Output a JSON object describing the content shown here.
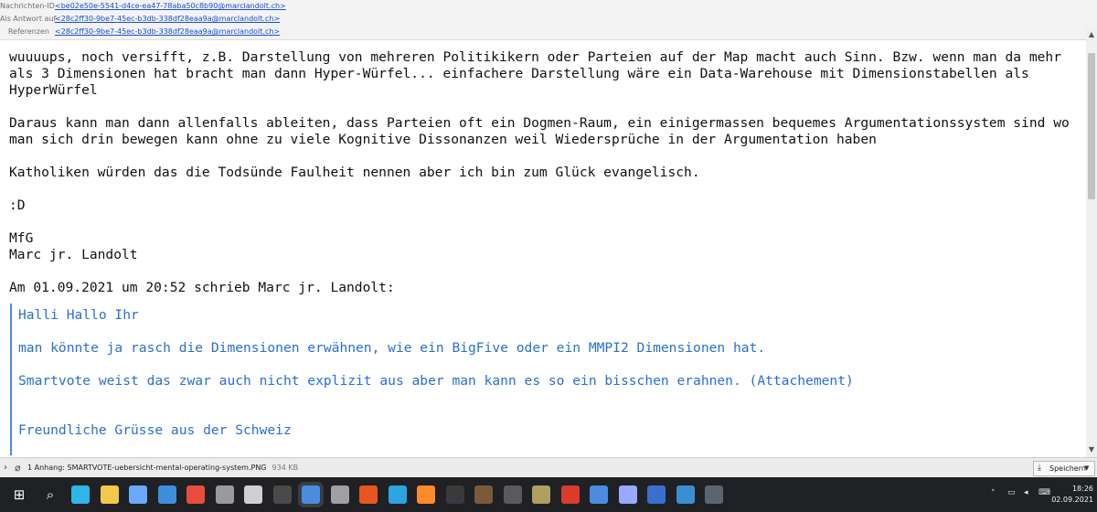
{
  "header": {
    "rows": [
      {
        "label": "Nachrichten-ID",
        "value": "<be02e50e-5541-d4ce-ea47-78aba50c8b90@marclandolt.ch>"
      },
      {
        "label": "Als Antwort auf",
        "value": "<28c2ff30-9be7-45ec-b3db-338df28eaa9a@marclandolt.ch>"
      },
      {
        "label": "Referenzen",
        "value": "<28c2ff30-9be7-45ec-b3db-338df28eaa9a@marclandolt.ch>"
      }
    ]
  },
  "message": {
    "paragraphs": [
      "wuuuups, noch versifft, z.B. Darstellung von mehreren Politikikern oder Parteien auf der Map macht auch Sinn. Bzw. wenn man da mehr als 3 Dimensionen hat bracht man dann Hyper-Würfel... einfachere Darstellung wäre ein Data-Warehouse mit Dimensionstabellen als HyperWürfel",
      "Daraus kann man dann allenfalls ableiten, dass Parteien oft ein Dogmen-Raum, ein einigermassen bequemes Argumentationssystem sind wo man sich drin bewegen kann ohne zu viele Kognitive Dissonanzen weil Wiedersprüche in der Argumentation haben",
      "Katholiken würden das die Todsünde Faulheit nennen aber ich bin zum Glück evangelisch.",
      ":D",
      "MfG",
      "Marc jr. Landolt",
      "Am 01.09.2021 um 20:52 schrieb Marc jr. Landolt:"
    ],
    "quote": [
      "Halli Hallo Ihr",
      "man könnte ja rasch die Dimensionen erwähnen, wie ein BigFive oder ein MMPI2 Dimensionen hat.",
      "Smartvote weist das zwar auch nicht explizit aus aber man kann es so ein bisschen erahnen. (Attachement)",
      "Freundliche Grüsse aus der Schweiz"
    ]
  },
  "attachment": {
    "text": "1 Anhang: SMARTVOTE-uebersicht-mental-operating-system.PNG",
    "size": "934 KB",
    "save_label": "Speichern"
  },
  "taskbar": {
    "apps": [
      {
        "icon": "windows-start-icon",
        "color": "#ffffff"
      },
      {
        "icon": "search-icon",
        "color": "#ffffff"
      },
      {
        "icon": "edge-browser-icon",
        "color": "#2fb5e8"
      },
      {
        "icon": "file-explorer-icon",
        "color": "#f2c94c"
      },
      {
        "icon": "store-icon",
        "color": "#6aa9ff"
      },
      {
        "icon": "mail-icon",
        "color": "#3d8fd9"
      },
      {
        "icon": "chrome-icon",
        "color": "#e74c3c"
      },
      {
        "icon": "gun-app-icon",
        "color": "#9a9a9a"
      },
      {
        "icon": "inkscape-icon",
        "color": "#cfcfcf"
      },
      {
        "icon": "live-app-icon",
        "color": "#4a4a4a"
      },
      {
        "icon": "thunderbird-icon",
        "color": "#4a8de0"
      },
      {
        "icon": "app-generic-icon",
        "color": "#a0a0a0"
      },
      {
        "icon": "ubuntu-icon",
        "color": "#e95420"
      },
      {
        "icon": "telegram-icon",
        "color": "#2ca5e0"
      },
      {
        "icon": "firefox-icon",
        "color": "#ff8a2a"
      },
      {
        "icon": "terminal-icon",
        "color": "#3a3a3a"
      },
      {
        "icon": "photo-app-icon",
        "color": "#7a5a3a"
      },
      {
        "icon": "kali-icon",
        "color": "#5a5a5a"
      },
      {
        "icon": "crossed-tools-icon",
        "color": "#b0a060"
      },
      {
        "icon": "voice-app-icon",
        "color": "#d93b2f"
      },
      {
        "icon": "mail-shortcut-icon",
        "color": "#4a8de0"
      },
      {
        "icon": "notepad-icon",
        "color": "#9aa8ff"
      },
      {
        "icon": "virtualbox-icon",
        "color": "#3a6fd0"
      },
      {
        "icon": "photos-icon",
        "color": "#3a8fd0"
      },
      {
        "icon": "calculator-icon",
        "color": "#5a6470"
      }
    ],
    "time": "18:26",
    "date": "02.09.2021"
  }
}
